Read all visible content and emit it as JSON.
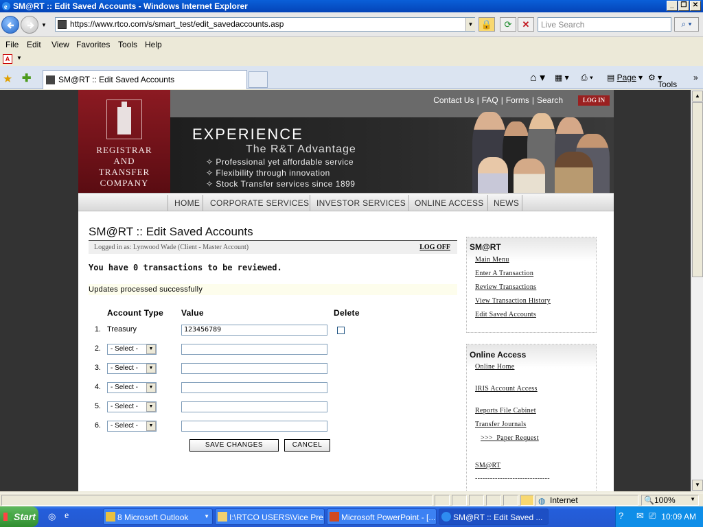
{
  "window": {
    "title": "SM@RT :: Edit Saved Accounts - Windows Internet Explorer"
  },
  "browser": {
    "url": "https://www.rtco.com/s/smart_test/edit_savedaccounts.asp",
    "search_placeholder": "Live Search",
    "menu": [
      "File",
      "Edit",
      "View",
      "Favorites",
      "Tools",
      "Help"
    ],
    "tab_title": "SM@RT :: Edit Saved Accounts",
    "cmd": {
      "page": "Page",
      "tools": "Tools"
    }
  },
  "site": {
    "logo_lines": [
      "REGISTRAR",
      "AND",
      "TRANSFER",
      "COMPANY"
    ],
    "top_links": [
      "Contact Us",
      "FAQ",
      "Forms",
      "Search"
    ],
    "login": "LOG IN",
    "banner": {
      "headline": "EXPERIENCE",
      "tagline": "The R&T Advantage",
      "bullets": [
        "Professional yet affordable service",
        "Flexibility through innovation",
        "Stock Transfer services since 1899"
      ]
    },
    "nav": [
      "HOME",
      "CORPORATE SERVICES",
      "INVESTOR SERVICES",
      "ONLINE ACCESS",
      "NEWS"
    ]
  },
  "main": {
    "title": "SM@RT :: Edit Saved Accounts",
    "logged_in": "Logged in as: Lynwood Wade (Client - Master Account)",
    "logoff": "LOG OFF",
    "tx_message": "You have 0 transactions to be reviewed.",
    "update_message": "Updates processed successfully",
    "columns": {
      "type": "Account Type",
      "value": "Value",
      "delete": "Delete"
    },
    "rows": [
      {
        "num": "1.",
        "type": "Treasury",
        "value": "123456789"
      },
      {
        "num": "2.",
        "type": "- Select -",
        "value": ""
      },
      {
        "num": "3.",
        "type": "- Select -",
        "value": ""
      },
      {
        "num": "4.",
        "type": "- Select -",
        "value": ""
      },
      {
        "num": "5.",
        "type": "- Select -",
        "value": ""
      },
      {
        "num": "6.",
        "type": "- Select -",
        "value": ""
      }
    ],
    "save_label": "SAVE CHANGES",
    "cancel_label": "CANCEL"
  },
  "sidebar": {
    "smart_title": "SM@RT",
    "smart_links": [
      "Main Menu",
      "Enter A Transaction",
      "Review Transactions",
      "View Transaction History",
      "Edit Saved Accounts"
    ],
    "online_title": "Online Access",
    "online_links": [
      "Online Home",
      "IRIS Account Access",
      "Reports File Cabinet",
      "Transfer Journals",
      ">>>  Paper Request",
      "SM@RT"
    ],
    "divider": "------------------------------"
  },
  "status": {
    "zone": "Internet",
    "zoom": "100%"
  },
  "taskbar": {
    "start": "Start",
    "items": [
      "8 Microsoft Outlook",
      "I:\\RTCO USERS\\Vice Pre...",
      "Microsoft PowerPoint - [...",
      "SM@RT :: Edit Saved ..."
    ],
    "clock": "10:09 AM"
  }
}
